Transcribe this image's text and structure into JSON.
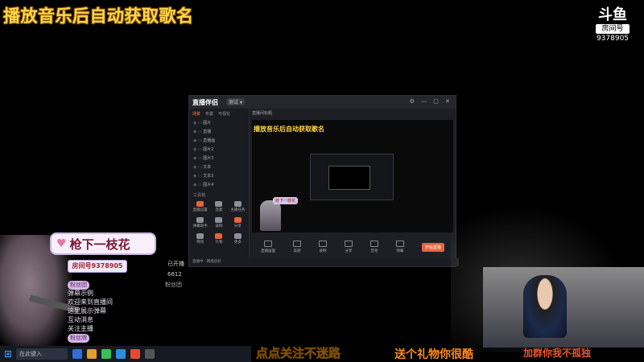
{
  "stream": {
    "overlay_title": "播放音乐后自动获取歌名",
    "platform_logo": "斗鱼",
    "room_label": "房间号",
    "room_number": "9378905",
    "streamer_name": "枪下一枝花",
    "room_card": "房间号9378905",
    "viewer_count": "6812",
    "fans_label": "粉丝团",
    "rec_label": "已开播"
  },
  "app": {
    "brand": "直播伴侣",
    "version": "测试 ▾",
    "tabs": [
      "场景",
      "布置",
      "可视化"
    ],
    "scenes": [
      "图片",
      "直播",
      "直播画",
      "图片2",
      "图片3",
      "文本",
      "文本3",
      "图片4"
    ],
    "tools_header": "工具箱",
    "tools": [
      "直播设置",
      "连麦",
      "主播任务",
      "弹幕助手",
      "录制",
      "分享",
      "特效",
      "礼物",
      "更多"
    ],
    "preview_header": "直播间标题",
    "preview_title": "播放音乐后自动获取歌名",
    "nested_name": "枪下一枝花",
    "toolbar": [
      "直播画面",
      "美颜",
      "录制",
      "分享",
      "音效",
      "弹幕"
    ],
    "start_label": "开始直播",
    "status_line": "直播中 · 网络良好"
  },
  "chat": {
    "lines": [
      "粉丝团",
      "弹幕示例",
      "欢迎来到直播间",
      "这里展示弹幕",
      "互动消息",
      "关注主播",
      "粉丝牌"
    ]
  },
  "taskbar": {
    "search_placeholder": "在此键入"
  },
  "ticker": {
    "line1": "点点关注不迷路",
    "line2": "送个礼物你很酷",
    "line3": "加群你我不孤独"
  },
  "colors": {
    "title_yellow": "#ffd54a",
    "accent_orange": "#e8643a",
    "name_red": "#7a1630"
  }
}
